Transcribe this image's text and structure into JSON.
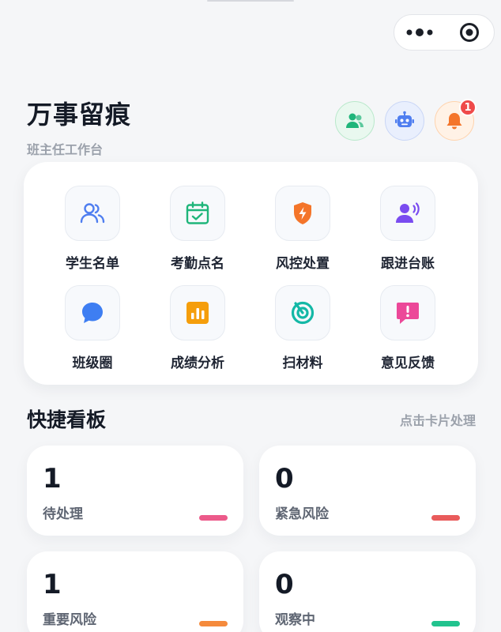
{
  "capsule": {
    "more_icon": "more-dots-icon",
    "close_icon": "target-close-icon"
  },
  "header": {
    "title": "万事留痕",
    "subtitle": "班主任工作台",
    "notification_count": "1"
  },
  "menu": [
    {
      "label": "学生名单",
      "icon": "students-icon",
      "color": "#4f7ef0"
    },
    {
      "label": "考勤点名",
      "icon": "calendar-check-icon",
      "color": "#1fb57a"
    },
    {
      "label": "风控处置",
      "icon": "shield-bolt-icon",
      "color": "#f4752a"
    },
    {
      "label": "跟进台账",
      "icon": "voice-user-icon",
      "color": "#7a4cf0"
    },
    {
      "label": "班级圈",
      "icon": "chat-bubble-icon",
      "color": "#3e7ef2"
    },
    {
      "label": "成绩分析",
      "icon": "bar-chart-icon",
      "color": "#f59e0b"
    },
    {
      "label": "扫材料",
      "icon": "scan-icon",
      "color": "#14b8a6"
    },
    {
      "label": "意见反馈",
      "icon": "feedback-icon",
      "color": "#ec4899"
    }
  ],
  "dashboard": {
    "title": "快捷看板",
    "hint": "点击卡片处理",
    "cards": [
      {
        "value": "1",
        "label": "待处理",
        "color": "#ec5a8a"
      },
      {
        "value": "0",
        "label": "紧急风险",
        "color": "#e95b5b"
      },
      {
        "value": "1",
        "label": "重要风险",
        "color": "#f58a3c"
      },
      {
        "value": "0",
        "label": "观察中",
        "color": "#22c38e"
      }
    ]
  }
}
